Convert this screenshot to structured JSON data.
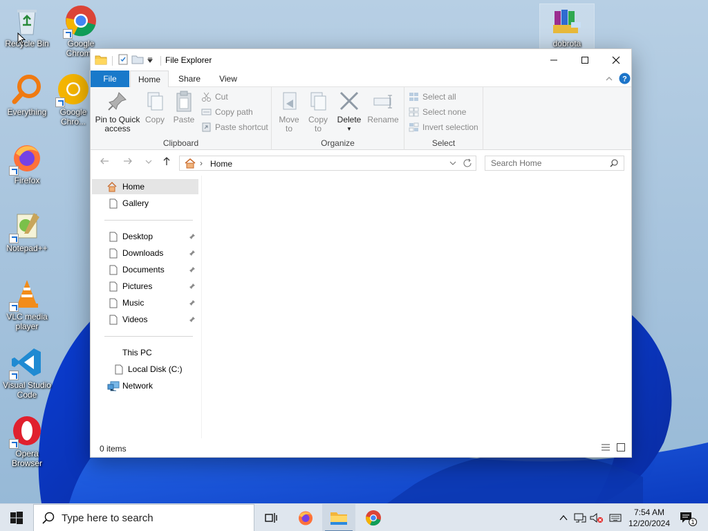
{
  "desktop": {
    "icons": [
      {
        "label": "Recycle Bin",
        "icon": "recycle-bin-icon"
      },
      {
        "label": "Google Chrome",
        "icon": "chrome-icon"
      },
      {
        "label": "dobrota",
        "icon": "winrar-archive-icon"
      },
      {
        "label": "Everything",
        "icon": "everything-search-icon"
      },
      {
        "label": "Google Chro...",
        "icon": "chrome-icon"
      },
      {
        "label": "Firefox",
        "icon": "firefox-icon"
      },
      {
        "label": "Notepad++",
        "icon": "notepad-plus-plus-icon"
      },
      {
        "label": "VLC media player",
        "icon": "vlc-icon"
      },
      {
        "label": "Visual Studio Code",
        "icon": "vscode-icon"
      },
      {
        "label": "Opera Browser",
        "icon": "opera-icon"
      }
    ]
  },
  "explorer": {
    "title": "File Explorer",
    "tabs": {
      "file": "File",
      "home": "Home",
      "share": "Share",
      "view": "View"
    },
    "ribbon": {
      "clipboard": {
        "group": "Clipboard",
        "pin_line1": "Pin to Quick",
        "pin_line2": "access",
        "copy": "Copy",
        "paste": "Paste",
        "cut": "Cut",
        "copy_path": "Copy path",
        "paste_shortcut": "Paste shortcut"
      },
      "organize": {
        "group": "Organize",
        "move_to_line1": "Move",
        "move_to_line2": "to",
        "copy_to_line1": "Copy",
        "copy_to_line2": "to",
        "delete": "Delete",
        "rename": "Rename"
      },
      "select": {
        "group": "Select",
        "select_all": "Select all",
        "select_none": "Select none",
        "invert_selection": "Invert selection"
      }
    },
    "address": {
      "path": "Home",
      "separator": "›"
    },
    "search": {
      "placeholder": "Search Home"
    },
    "nav": {
      "home": "Home",
      "gallery": "Gallery",
      "quick_access": [
        "Desktop",
        "Downloads",
        "Documents",
        "Pictures",
        "Music",
        "Videos"
      ],
      "this_pc": "This PC",
      "local_disk": "Local Disk (C:)",
      "network": "Network"
    },
    "status": {
      "items": "0 items"
    }
  },
  "taskbar": {
    "search_placeholder": "Type here to search",
    "apps": [
      "task-view-icon",
      "firefox-icon",
      "file-explorer-icon",
      "chrome-icon"
    ],
    "clock": {
      "time": "7:54 AM",
      "date": "12/20/2024"
    },
    "notifications_count": "1"
  },
  "colors": {
    "accent": "#1979ca",
    "taskbar": "#dfe6ee",
    "selection": "#e5e5e5"
  }
}
